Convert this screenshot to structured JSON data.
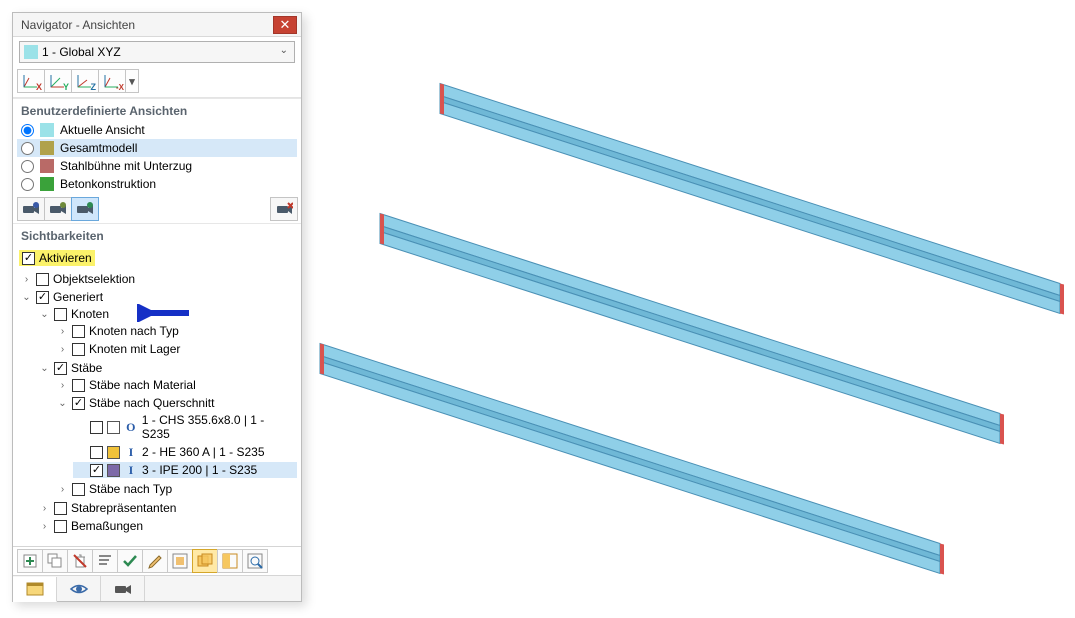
{
  "panel": {
    "title": "Navigator - Ansichten"
  },
  "view_selector": {
    "swatch_color": "#9be2e8",
    "value": "1 - Global XYZ"
  },
  "axis_buttons": [
    {
      "name": "axis-x",
      "glyph": "X"
    },
    {
      "name": "axis-y",
      "glyph": "Y"
    },
    {
      "name": "axis-z",
      "glyph": "Z"
    },
    {
      "name": "axis-neg-x",
      "glyph": "-X"
    }
  ],
  "user_views": {
    "heading": "Benutzerdefinierte Ansichten",
    "items": [
      {
        "label": "Aktuelle Ansicht",
        "swatch": "#9be2e8",
        "checked": true,
        "selected": false
      },
      {
        "label": "Gesamtmodell",
        "swatch": "#b0a24b",
        "checked": false,
        "selected": true
      },
      {
        "label": "Stahlbühne mit Unterzug",
        "swatch": "#b96a67",
        "checked": false,
        "selected": false
      },
      {
        "label": "Betonkonstruktion",
        "swatch": "#3aa23a",
        "checked": false,
        "selected": false
      }
    ]
  },
  "camera_buttons": [
    {
      "name": "camera-1",
      "accent": "#3a5aa8",
      "active": false
    },
    {
      "name": "camera-2",
      "accent": "#6f8a3a",
      "active": false
    },
    {
      "name": "camera-3",
      "accent": "#2d8a52",
      "active": true
    }
  ],
  "camera_delete": {
    "name": "camera-delete"
  },
  "visibilities": {
    "heading": "Sichtbarkeiten",
    "activate_label": "Aktivieren",
    "activate_checked": true,
    "tree": {
      "objektselektion": {
        "label": "Objektselektion",
        "checked": false
      },
      "generiert": {
        "label": "Generiert",
        "checked": true,
        "knoten": {
          "label": "Knoten",
          "checked": false,
          "children": [
            {
              "label": "Knoten nach Typ",
              "checked": false
            },
            {
              "label": "Knoten mit Lager",
              "checked": false
            }
          ]
        },
        "staebe": {
          "label": "Stäbe",
          "checked": true,
          "children": [
            {
              "label": "Stäbe nach Material",
              "checked": false,
              "expanded": false
            },
            {
              "label": "Stäbe nach Querschnitt",
              "checked": true,
              "expanded": true,
              "items": [
                {
                  "label": "1 - CHS 355.6x8.0 | 1 - S235",
                  "checked": false,
                  "swatch": "#ffffff",
                  "icon": "O"
                },
                {
                  "label": "2 - HE 360 A | 1 - S235",
                  "checked": false,
                  "swatch": "#f0c23a",
                  "icon": "I"
                },
                {
                  "label": "3 - IPE 200 | 1 - S235",
                  "checked": true,
                  "swatch": "#7d6aa8",
                  "icon": "I",
                  "selected": true
                }
              ]
            },
            {
              "label": "Stäbe nach Typ",
              "checked": false,
              "expanded": false
            }
          ]
        },
        "stabrep": {
          "label": "Stabrepräsentanten",
          "checked": false
        },
        "bemass": {
          "label": "Bemaßungen",
          "checked": false
        }
      }
    }
  },
  "bottom_toolbar": [
    {
      "name": "btn-new",
      "active": false
    },
    {
      "name": "btn-dup",
      "active": false
    },
    {
      "name": "btn-del",
      "active": false
    },
    {
      "name": "btn-sort",
      "active": false
    },
    {
      "name": "btn-apply",
      "active": false
    },
    {
      "name": "btn-edit",
      "active": false
    },
    {
      "name": "btn-filter",
      "active": false
    },
    {
      "name": "btn-union",
      "active": true
    },
    {
      "name": "btn-invert",
      "active": false
    },
    {
      "name": "btn-isolate",
      "active": false
    }
  ],
  "tabs": [
    {
      "name": "tab-data",
      "icon": "data",
      "active": true
    },
    {
      "name": "tab-views",
      "icon": "eye",
      "active": false
    },
    {
      "name": "tab-cams",
      "icon": "cam",
      "active": false
    }
  ],
  "colors": {
    "beam_fill": "#8fcfe8",
    "beam_stroke": "#4a90b5",
    "beam_end": "#d9534f"
  }
}
